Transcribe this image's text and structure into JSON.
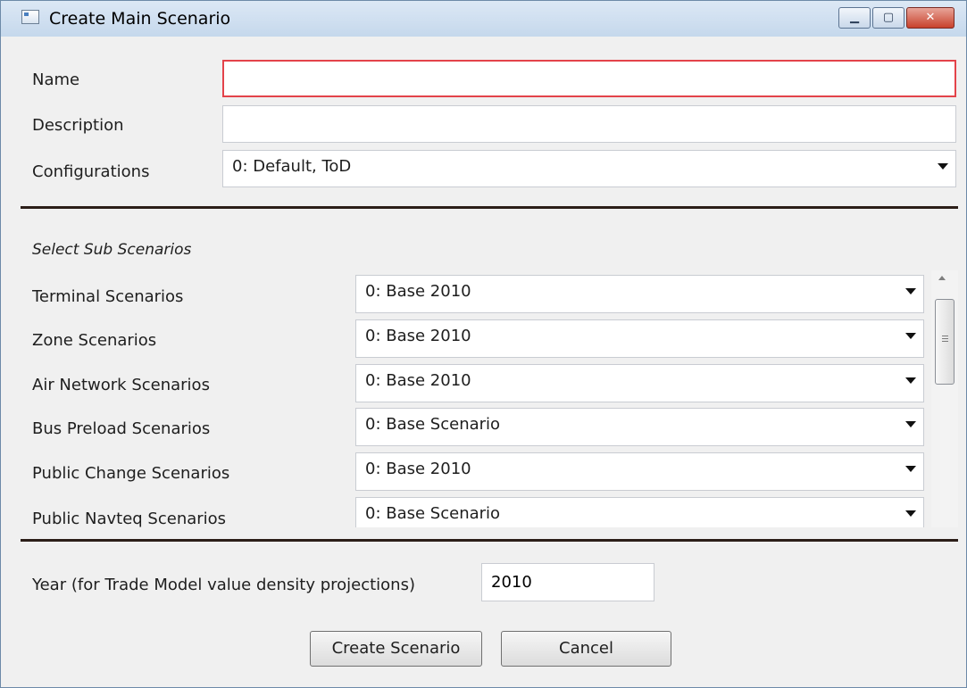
{
  "window": {
    "title": "Create Main Scenario",
    "controls": {
      "minimize": "▁",
      "maximize": "▢",
      "close": "✕"
    }
  },
  "form": {
    "name": {
      "label": "Name",
      "value": ""
    },
    "description": {
      "label": "Description",
      "value": ""
    },
    "configurations": {
      "label": "Configurations",
      "selected": "0: Default, ToD"
    }
  },
  "sub_scenarios": {
    "heading": "Select Sub Scenarios",
    "rows": [
      {
        "label": "Terminal Scenarios",
        "selected": "0: Base 2010"
      },
      {
        "label": "Zone Scenarios",
        "selected": "0: Base 2010"
      },
      {
        "label": "Air Network Scenarios",
        "selected": "0: Base 2010"
      },
      {
        "label": "Bus Preload Scenarios",
        "selected": "0: Base Scenario"
      },
      {
        "label": "Public Change Scenarios",
        "selected": "0: Base 2010"
      },
      {
        "label": "Public Navteq Scenarios",
        "selected": "0: Base Scenario"
      }
    ]
  },
  "year": {
    "label": "Year (for Trade Model value density projections)",
    "value": "2010"
  },
  "buttons": {
    "create": "Create Scenario",
    "cancel": "Cancel"
  }
}
